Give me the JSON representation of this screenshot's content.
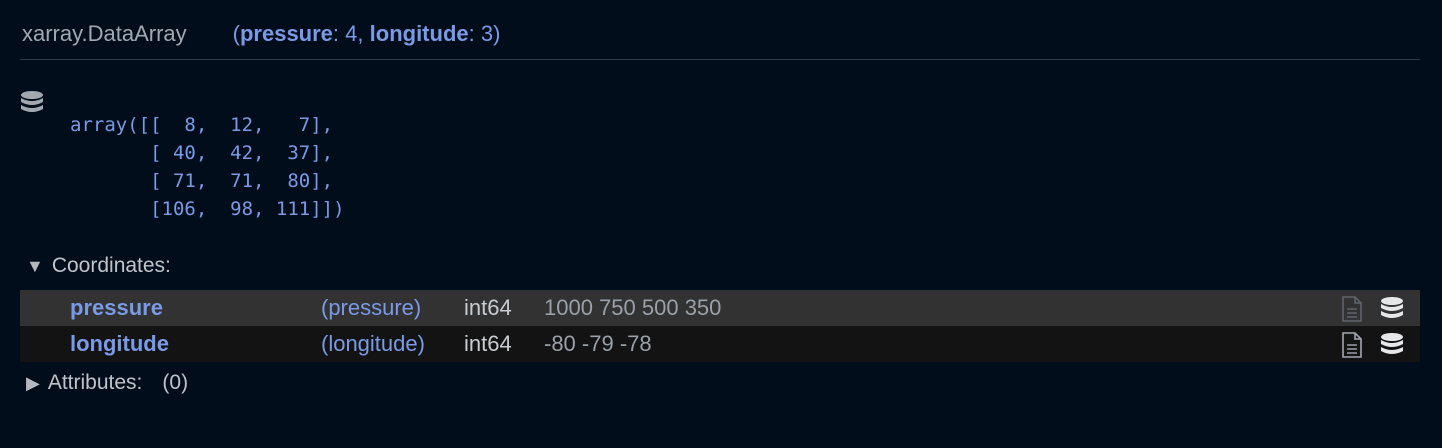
{
  "header": {
    "object_type": "xarray.DataArray",
    "dims_open": "(",
    "dims": [
      {
        "name": "pressure",
        "size": "4"
      },
      {
        "name": "longitude",
        "size": "3"
      }
    ],
    "dims_sep": ", ",
    "dims_close": ")"
  },
  "data_preview": {
    "icon": "database-icon",
    "text": "array([[  8,  12,   7],\n       [ 40,  42,  37],\n       [ 71,  71,  80],\n       [106,  98, 111]])"
  },
  "coordinates": {
    "expanded": true,
    "toggle_glyph": "▼",
    "label": "Coordinates:",
    "rows": [
      {
        "name": "pressure",
        "dims": "(pressure)",
        "dtype": "int64",
        "preview": "1000 750 500 350"
      },
      {
        "name": "longitude",
        "dims": "(longitude)",
        "dtype": "int64",
        "preview": "-80 -79 -78"
      }
    ]
  },
  "attributes": {
    "expanded": false,
    "toggle_glyph": "▶",
    "label": "Attributes:",
    "count": "(0)"
  },
  "colors": {
    "background": "#010d1a",
    "accent": "#7b9ae6",
    "row_highlight": "#323232",
    "row_alt": "#131313"
  }
}
